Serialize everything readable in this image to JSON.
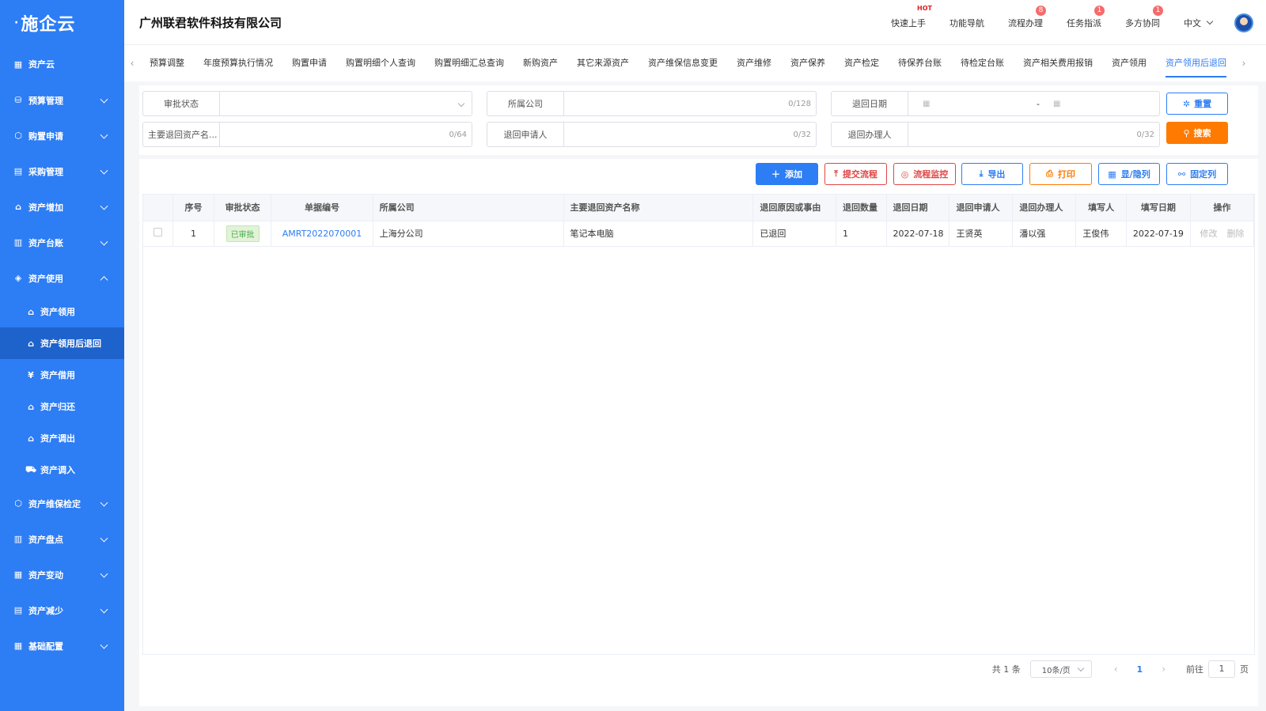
{
  "sidebar": {
    "logo": "施企云",
    "items": [
      {
        "label": "资产云",
        "icon": "grid-icon"
      },
      {
        "label": "预算管理",
        "icon": "database-icon"
      },
      {
        "label": "购置申请",
        "icon": "box-icon"
      },
      {
        "label": "采购管理",
        "icon": "clipboard-icon"
      },
      {
        "label": "资产增加",
        "icon": "home-plus-icon"
      },
      {
        "label": "资产台账",
        "icon": "ledger-icon"
      },
      {
        "label": "资产使用",
        "icon": "layers-icon"
      },
      {
        "label": "资产维保检定",
        "icon": "box-icon"
      },
      {
        "label": "资产盘点",
        "icon": "ledger-icon"
      },
      {
        "label": "资产变动",
        "icon": "grid-icon"
      },
      {
        "label": "资产减少",
        "icon": "clipboard-icon"
      },
      {
        "label": "基础配置",
        "icon": "grid-icon"
      }
    ],
    "sub_items": [
      {
        "label": "资产领用",
        "icon": "house-icon"
      },
      {
        "label": "资产领用后退回",
        "icon": "house-icon"
      },
      {
        "label": "资产借用",
        "icon": "yen-icon"
      },
      {
        "label": "资产归还",
        "icon": "house-icon"
      },
      {
        "label": "资产调出",
        "icon": "house-icon"
      },
      {
        "label": "资产调入",
        "icon": "truck-icon"
      }
    ]
  },
  "header": {
    "company": "广州联君软件科技有限公司",
    "links": [
      {
        "label": "快速上手",
        "badge": "HOT"
      },
      {
        "label": "功能导航",
        "badge": ""
      },
      {
        "label": "流程办理",
        "badge": "8"
      },
      {
        "label": "任务指派",
        "badge": "1"
      },
      {
        "label": "多方协同",
        "badge": "1"
      }
    ],
    "language": "中文"
  },
  "tabs": [
    "预算调整",
    "年度预算执行情况",
    "购置申请",
    "购置明细个人查询",
    "购置明细汇总查询",
    "新购资产",
    "其它来源资产",
    "资产维保信息变更",
    "资产维修",
    "资产保养",
    "资产检定",
    "待保养台账",
    "待检定台账",
    "资产相关费用报销",
    "资产领用",
    "资产领用后退回"
  ],
  "filters": {
    "approval_status": {
      "label": "审批状态",
      "value": ""
    },
    "company": {
      "label": "所属公司",
      "value": "",
      "count": "0/128"
    },
    "return_date": {
      "label": "退回日期",
      "separator": "-"
    },
    "asset_name": {
      "label": "主要退回资产名...",
      "value": "",
      "count": "0/64"
    },
    "applicant": {
      "label": "退回申请人",
      "value": "",
      "count": "0/32"
    },
    "handler": {
      "label": "退回办理人",
      "value": "",
      "count": "0/32"
    },
    "reset_label": "重置",
    "search_label": "搜索"
  },
  "toolbar": {
    "add": "添加",
    "submit": "提交流程",
    "monitor": "流程监控",
    "export": "导出",
    "print": "打印",
    "columns": "显/隐列",
    "fix": "固定列"
  },
  "table": {
    "headers": [
      "序号",
      "审批状态",
      "单据编号",
      "所属公司",
      "主要退回资产名称",
      "退回原因或事由",
      "退回数量",
      "退回日期",
      "退回申请人",
      "退回办理人",
      "填写人",
      "填写日期",
      "操作"
    ],
    "rows": [
      {
        "index": "1",
        "status": "已审批",
        "doc_no": "AMRT2022070001",
        "company": "上海分公司",
        "asset_name": "笔记本电脑",
        "reason": "已退回",
        "quantity": "1",
        "return_date": "2022-07-18",
        "applicant": "王贤英",
        "handler": "潘以强",
        "filler": "王俊伟",
        "fill_date": "2022-07-19",
        "edit": "修改",
        "delete": "删除"
      }
    ]
  },
  "pagination": {
    "total": "共 1 条",
    "page_size": "10条/页",
    "current": "1",
    "goto_prefix": "前往",
    "goto_value": "1",
    "goto_suffix": "页"
  },
  "colors": {
    "sidebar": "#2d7df4",
    "sidebar_active": "#1e62cc",
    "primary": "#2d7df4",
    "search": "#ff7a00",
    "danger": "#e04646"
  }
}
